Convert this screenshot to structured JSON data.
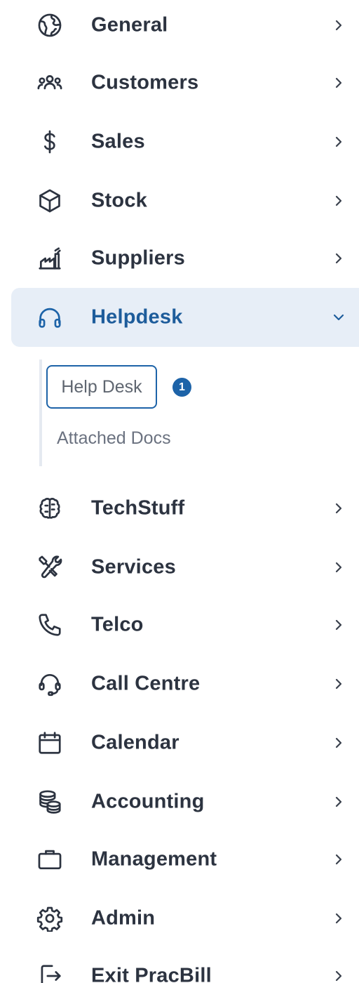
{
  "nav": {
    "items": [
      {
        "label": "General",
        "icon": "globe-icon"
      },
      {
        "label": "Customers",
        "icon": "users-icon"
      },
      {
        "label": "Sales",
        "icon": "dollar-icon"
      },
      {
        "label": "Stock",
        "icon": "box-icon"
      },
      {
        "label": "Suppliers",
        "icon": "factory-icon"
      },
      {
        "label": "Helpdesk",
        "icon": "headphones-icon",
        "expanded": true
      },
      {
        "label": "TechStuff",
        "icon": "brain-icon"
      },
      {
        "label": "Services",
        "icon": "tools-icon"
      },
      {
        "label": "Telco",
        "icon": "phone-icon"
      },
      {
        "label": "Call Centre",
        "icon": "headset-icon"
      },
      {
        "label": "Calendar",
        "icon": "calendar-icon"
      },
      {
        "label": "Accounting",
        "icon": "coins-icon"
      },
      {
        "label": "Management",
        "icon": "briefcase-icon"
      },
      {
        "label": "Admin",
        "icon": "gear-icon"
      },
      {
        "label": "Exit PracBill",
        "icon": "exit-icon"
      }
    ]
  },
  "submenu": {
    "items": [
      {
        "label": "Help Desk",
        "badge": "1",
        "selected": true
      },
      {
        "label": "Attached Docs"
      }
    ]
  },
  "colors": {
    "accent": "#1d63a8",
    "active_bg": "#e7eef7",
    "text": "#2c3340"
  }
}
